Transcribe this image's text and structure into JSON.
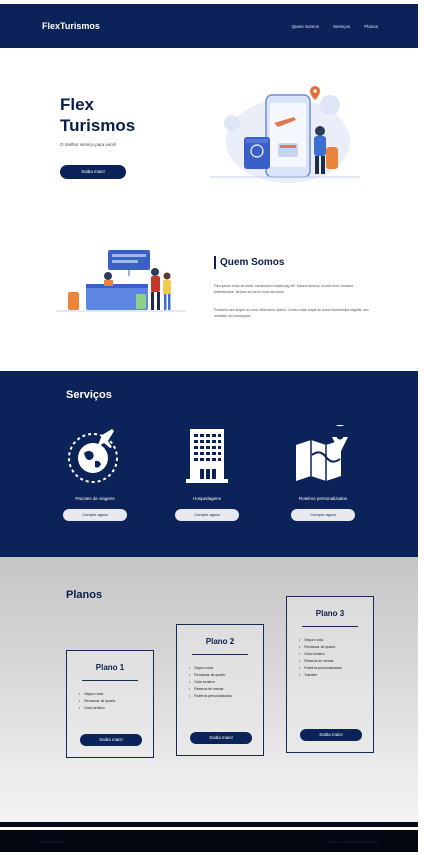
{
  "header": {
    "logo": "FlexTurismos",
    "nav": [
      "Quem Somos",
      "Serviços",
      "Planos"
    ]
  },
  "hero": {
    "title": "Flex Turismos",
    "subtitle": "O melhor serviço para você!",
    "button": "Saiba mais!"
  },
  "about": {
    "title": "Quem Somos",
    "p1": "Flex ipsum dolor sit amet, consectetur adipiscing elit. Mauris tempus mi sed nunc rhoncus pellentesque. Nullam ac nisl in risus tincidunt.",
    "p2": "Praesent sed augue eu nunc bibendum dictum. Donec vitae turpis ac lorem scelerisque sagittis, nec molestie dui consequat."
  },
  "services": {
    "title": "Serviços",
    "items": [
      {
        "label": "Pacotes de viagens",
        "button": "Compre agora",
        "icon": "globe-plane-icon"
      },
      {
        "label": "Hospedagens",
        "button": "Compre agora",
        "icon": "building-icon"
      },
      {
        "label": "Roteiros personalizados",
        "button": "Compre agora",
        "icon": "map-pin-icon"
      }
    ]
  },
  "plans": {
    "title": "Planos",
    "items": [
      {
        "title": "Plano 1",
        "features": [
          "Seguro vida",
          "Remarcar de quarto",
          "Guia turístico"
        ],
        "button": "Saiba mais!"
      },
      {
        "title": "Plano 2",
        "features": [
          "Seguro vida",
          "Remarcar de quarto",
          "Guia turístico",
          "Reserva de mesas",
          "Roteiros personalizados"
        ],
        "button": "Saiba mais!"
      },
      {
        "title": "Plano 3",
        "features": [
          "Seguro vida",
          "Remarcar de quarto",
          "Guia turístico",
          "Reserva de mesas",
          "Roteiros personalizados",
          "Transfer"
        ],
        "button": "Saiba mais!"
      }
    ]
  },
  "footer": {
    "left": "Flex Turismos",
    "right": "Todos os direitos reservados"
  },
  "colors": {
    "navy": "#0b2358",
    "white": "#ffffff",
    "accent_orange": "#f2a33a",
    "accent_blue": "#3b6fd1"
  }
}
